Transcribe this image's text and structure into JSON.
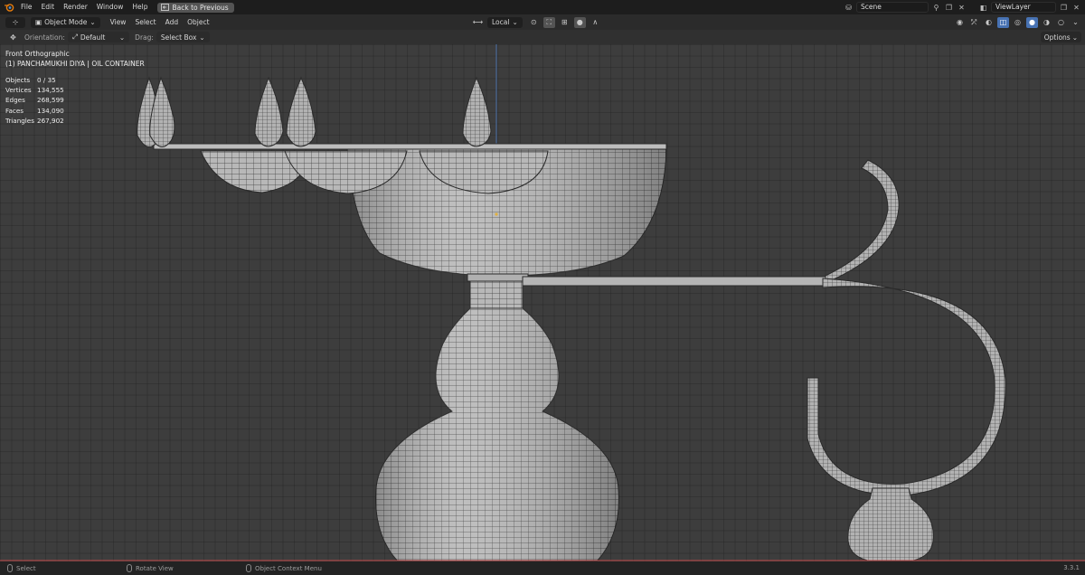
{
  "topbar": {
    "menus": [
      "File",
      "Edit",
      "Render",
      "Window",
      "Help"
    ],
    "back_label": "Back to Previous",
    "scene_name": "Scene",
    "view_layer_name": "ViewLayer"
  },
  "header": {
    "mode": "Object Mode",
    "menus": [
      "View",
      "Select",
      "Add",
      "Object"
    ],
    "transform_orientation": "Local"
  },
  "toolrow": {
    "orientation_label": "Orientation:",
    "orientation_value": "Default",
    "drag_label": "Drag:",
    "drag_value": "Select Box",
    "options_label": "Options"
  },
  "viewport": {
    "view_name": "Front Orthographic",
    "object_name": "(1) PANCHAMUKHI DIYA | OIL CONTAINER",
    "stats": [
      {
        "label": "Objects",
        "value": "0 / 35"
      },
      {
        "label": "Vertices",
        "value": "134,555"
      },
      {
        "label": "Edges",
        "value": "268,599"
      },
      {
        "label": "Faces",
        "value": "134,090"
      },
      {
        "label": "Triangles",
        "value": "267,902"
      }
    ]
  },
  "statusbar": {
    "select": "Select",
    "rotate": "Rotate View",
    "context": "Object Context Menu",
    "version": "3.3.1"
  },
  "icons": {
    "blender": "blender-logo-icon",
    "editor": "3d-viewport-icon",
    "transform": "move-tool-icon"
  },
  "colors": {
    "accent": "#4772b3",
    "mesh": "#b4b4b4",
    "wire": "#2a2a2a"
  }
}
